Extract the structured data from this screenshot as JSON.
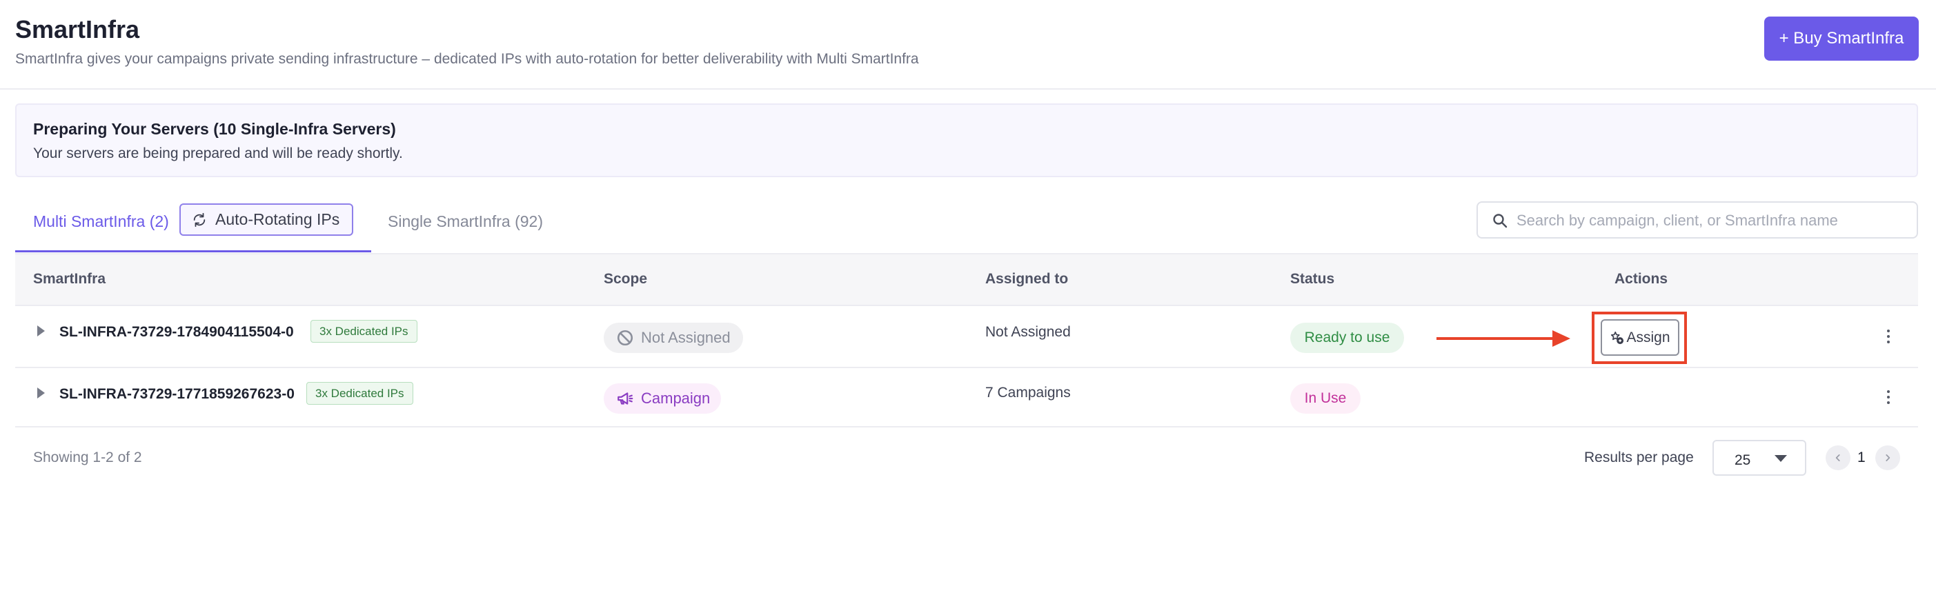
{
  "header": {
    "title": "SmartInfra",
    "subtitle": "SmartInfra gives your campaigns private sending infrastructure – dedicated IPs with auto-rotation for better deliverability with Multi SmartInfra",
    "buy_button": "+ Buy SmartInfra"
  },
  "banner": {
    "title": "Preparing Your Servers (10 Single-Infra Servers)",
    "text": "Your servers are being prepared and will be ready shortly."
  },
  "tabs": {
    "multi": "Multi SmartInfra (2)",
    "auto_rotating": "Auto-Rotating IPs",
    "single": "Single SmartInfra (92)"
  },
  "search": {
    "placeholder": "Search by campaign, client, or SmartInfra name",
    "value": ""
  },
  "table": {
    "columns": [
      "SmartInfra",
      "Scope",
      "Assigned to",
      "Status",
      "Actions"
    ],
    "rows": [
      {
        "name": "SL-INFRA-73729-1784904115504-0",
        "badge": "3x Dedicated IPs",
        "scope": "Not Assigned",
        "assigned_to": "Not Assigned",
        "status": "Ready to use",
        "action": "Assign"
      },
      {
        "name": "SL-INFRA-73729-1771859267623-0",
        "badge": "3x Dedicated IPs",
        "scope": "Campaign",
        "assigned_to": "7 Campaigns",
        "status": "In Use"
      }
    ]
  },
  "footer": {
    "showing": "Showing 1-2 of 2",
    "results_per_page_label": "Results per page",
    "results_per_page": "25",
    "current_page": "1"
  },
  "colors": {
    "accent": "#6b5ae8",
    "annotation": "#e8432a",
    "ready": "#2f8d44",
    "in_use": "#c2319a"
  },
  "icons": [
    "refresh-icon",
    "search-icon",
    "caret-right-icon",
    "block-icon",
    "megaphone-icon",
    "assign-icon",
    "kebab-icon",
    "chevron-down-icon",
    "chevron-left-icon",
    "chevron-right-icon"
  ]
}
